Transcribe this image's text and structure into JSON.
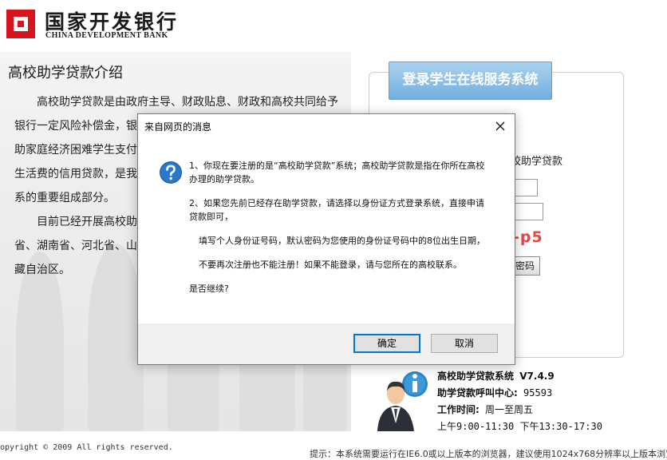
{
  "header": {
    "logo_cn": "国家开发银行",
    "logo_en": "CHINA DEVELOPMENT BANK"
  },
  "intro": {
    "title": "高校助学贷款介绍",
    "lines": [
      "　　高校助学贷款是由政府主导、财政贴息、财政和高校共同给予",
      "银行一定风险补偿金，银",
      "助家庭经济困难学生支付",
      "生活费的信用贷款，是我",
      "系的重要组成部分。",
      "　　目前已经开展高校助",
      "省、湖南省、河北省、山",
      "藏自治区。"
    ]
  },
  "login": {
    "tab_label": "登录学生在线服务系统",
    "partial_text": "校助学贷款",
    "captcha_text": "-p5",
    "button_partial": "密码"
  },
  "help": {
    "system_label": "高校助学贷款系统",
    "version": "V7.4.9",
    "hotline_label": "助学贷款呼叫中心:",
    "hotline_number": "95593",
    "hours_label": "工作时间:",
    "days": "周一至周五",
    "hours": "上午9:00-11:30  下午13:30-17:30"
  },
  "footer": {
    "copyright": "opyright © 2009 All rights reserved.",
    "tip": "提示：本系统需要运行在IE6.0或以上版本的浏览器，建议使用1024x768分辨率以上版本浏览"
  },
  "dialog": {
    "title": "来自网页的消息",
    "paragraphs": [
      "1、你现在要注册的是“高校助学贷款”系统；高校助学贷款是指在你所在高校办理的助学贷款。",
      "2、如果您先前已经存在助学贷款，请选择以身份证方式登录系统，直接申请贷款即可，",
      "填写个人身份证号码，默认密码为您使用的身份证号码中的8位出生日期，",
      "不要再次注册也不能注册！如果不能登录，请与您所在的高校联系。",
      "是否继续?"
    ],
    "ok_label": "确定",
    "cancel_label": "取消"
  },
  "colors": {
    "brand_red": "#d7151e",
    "tab_blue": "#8cc0e8",
    "dialog_focus": "#0078d7",
    "captcha_red": "#e24a4a"
  }
}
